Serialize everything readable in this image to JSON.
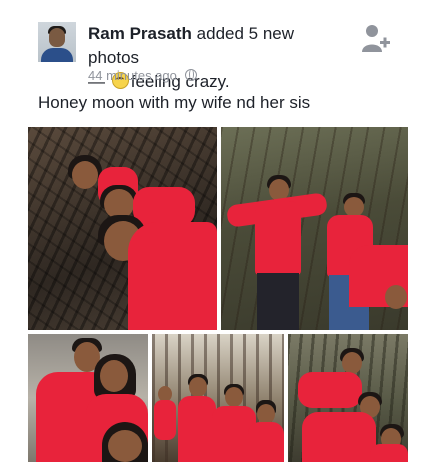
{
  "post": {
    "author_name": "Ram Prasath",
    "action_text": " added 5 new photos",
    "dash": "— ",
    "feeling_text": "feeling crazy.",
    "timestamp": "44 minutes ago",
    "caption": "Honey moon with my wife nd her sis",
    "feeling_icon": "crazy-emoji",
    "privacy_icon": "globe-icon",
    "action_icon": "add-friend-icon"
  },
  "photos": [
    {
      "subject": "three people in red shirts selfie among roots"
    },
    {
      "subject": "group posing on forest trail"
    },
    {
      "subject": "couple selfie"
    },
    {
      "subject": "group standing in forest"
    },
    {
      "subject": "group selfie in forest"
    }
  ],
  "colors": {
    "shirt_red": "#e8233b",
    "text": "#1d2129",
    "meta_grey": "#90949c"
  }
}
